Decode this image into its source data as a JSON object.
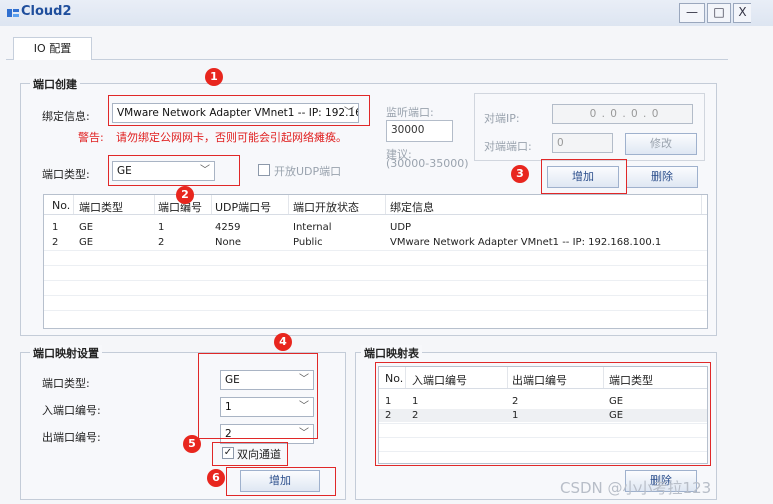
{
  "window": {
    "title": "Cloud2",
    "min_btn": "—",
    "max_btn": "□",
    "close_btn": "X"
  },
  "tabs": [
    {
      "label": "IO 配置"
    }
  ],
  "port_create": {
    "legend": "端口创建",
    "bind_label": "绑定信息:",
    "bind_value": "VMware Network Adapter VMnet1 -- IP: 192.16",
    "warn_label": "警告:",
    "warn_text": "请勿绑定公网网卡，否则可能会引起网络瘫痪。",
    "type_label": "端口类型:",
    "type_value": "GE",
    "udp_checkbox_label": "开放UDP端口",
    "listen_label": "监听端口:",
    "listen_value": "30000",
    "suggest_label": "建议:",
    "suggest_range": "(30000-35000)",
    "peer_ip_label": "对端IP:",
    "peer_ip_value": "0 . 0 . 0 . 0",
    "peer_port_label": "对端端口:",
    "peer_port_value": "0",
    "modify_btn": "修改",
    "add_btn": "增加",
    "delete_btn": "删除"
  },
  "port_table": {
    "headers": [
      "No.",
      "端口类型",
      "端口编号",
      "UDP端口号",
      "端口开放状态",
      "绑定信息"
    ],
    "rows": [
      [
        "1",
        "GE",
        "1",
        "4259",
        "Internal",
        "UDP"
      ],
      [
        "2",
        "GE",
        "2",
        "None",
        "Public",
        "VMware Network Adapter VMnet1 -- IP: 192.168.100.1"
      ]
    ]
  },
  "mapping_settings": {
    "legend": "端口映射设置",
    "type_label": "端口类型:",
    "type_value": "GE",
    "in_label": "入端口编号:",
    "in_value": "1",
    "out_label": "出端口编号:",
    "out_value": "2",
    "bidirectional_label": "双向通道",
    "add_btn": "增加"
  },
  "mapping_table": {
    "legend": "端口映射表",
    "headers": [
      "No.",
      "入端口编号",
      "出端口编号",
      "端口类型"
    ],
    "rows": [
      [
        "1",
        "1",
        "2",
        "GE"
      ],
      [
        "2",
        "2",
        "1",
        "GE"
      ]
    ],
    "delete_btn": "删除"
  },
  "annotations": [
    "1",
    "2",
    "3",
    "4",
    "5",
    "6"
  ],
  "watermark": "CSDN @小小考拉123",
  "colors": {
    "accent": "#1f4e9c",
    "annotation": "#e8261e",
    "warning": "#e02020"
  }
}
